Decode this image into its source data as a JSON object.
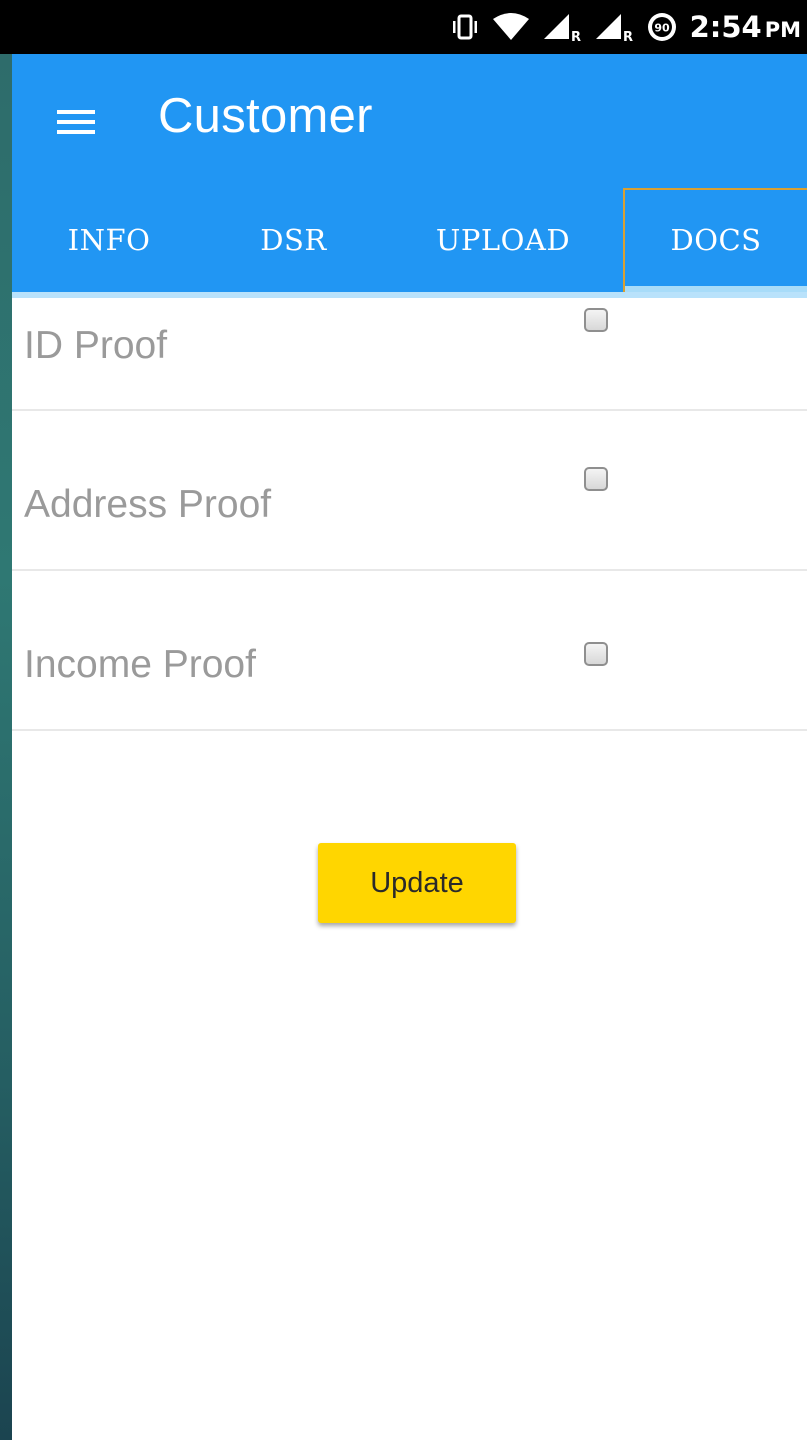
{
  "status_bar": {
    "time": "2:54",
    "ampm": "PM",
    "battery_level": "90",
    "icons": [
      "vibrate-icon",
      "wifi-icon",
      "signal-roaming-icon",
      "signal-roaming-icon",
      "battery-saver-icon"
    ]
  },
  "app_bar": {
    "title": "Customer",
    "menu_icon": "hamburger-menu-icon"
  },
  "tabs": [
    {
      "label": "INFO",
      "active": false
    },
    {
      "label": "DSR",
      "active": false
    },
    {
      "label": "UPLOAD",
      "active": false
    },
    {
      "label": "DOCS",
      "active": true
    }
  ],
  "documents": [
    {
      "label": "ID Proof",
      "checked": false
    },
    {
      "label": "Address Proof",
      "checked": false
    },
    {
      "label": "Income Proof",
      "checked": false
    }
  ],
  "update_button": {
    "label": "Update"
  },
  "colors": {
    "primary": "#2196f3",
    "accent": "#ffd600",
    "tab_indicator": "#a8dcf9",
    "label_text": "#9a9a9a"
  }
}
